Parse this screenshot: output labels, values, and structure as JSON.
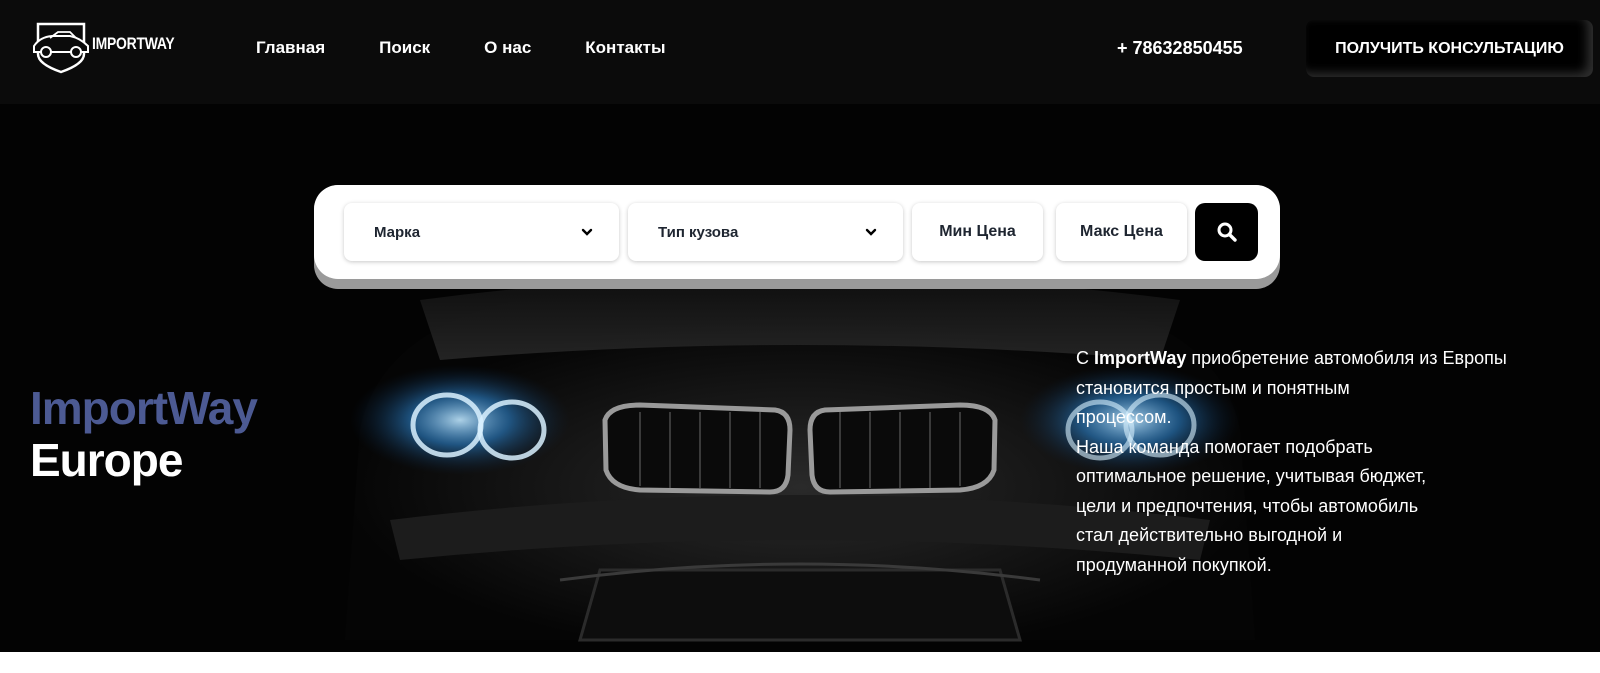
{
  "header": {
    "logo_text": "IMPORTWAY",
    "logo_icon": "car-shield-icon",
    "nav": [
      "Главная",
      "Поиск",
      "О нас",
      "Контакты"
    ],
    "phone": "+ 78632850455",
    "cta_label": "ПОЛУЧИТЬ КОНСУЛЬТАЦИЮ"
  },
  "search": {
    "brand_placeholder": "Марка",
    "body_placeholder": "Тип кузова",
    "min_price": "Мин Цена",
    "max_price": "Макс Цена",
    "search_icon": "search-icon",
    "dropdown_icon": "chevron-down-icon"
  },
  "hero": {
    "title_line1": "ImportWay",
    "title_line2": "Europe",
    "desc_prefix": "С ",
    "desc_brand": "ImportWay",
    "desc_line1_rest": " приобретение автомобиля из Европы",
    "desc_lines": [
      "становится простым и понятным",
      "процессом.",
      "Наша команда помогает подобрать",
      "оптимальное решение, учитывая бюджет,",
      "цели и предпочтения, чтобы автомобиль",
      "стал действительно выгодной и",
      "продуманной покупкой."
    ],
    "background_image": "car-front-headlights"
  },
  "colors": {
    "header_bg": "#0b0b0b",
    "hero_bg": "#030303",
    "accent_title": "#4c5a93",
    "button_bg": "#000000",
    "headlight_glow": "#3aa0ff"
  }
}
